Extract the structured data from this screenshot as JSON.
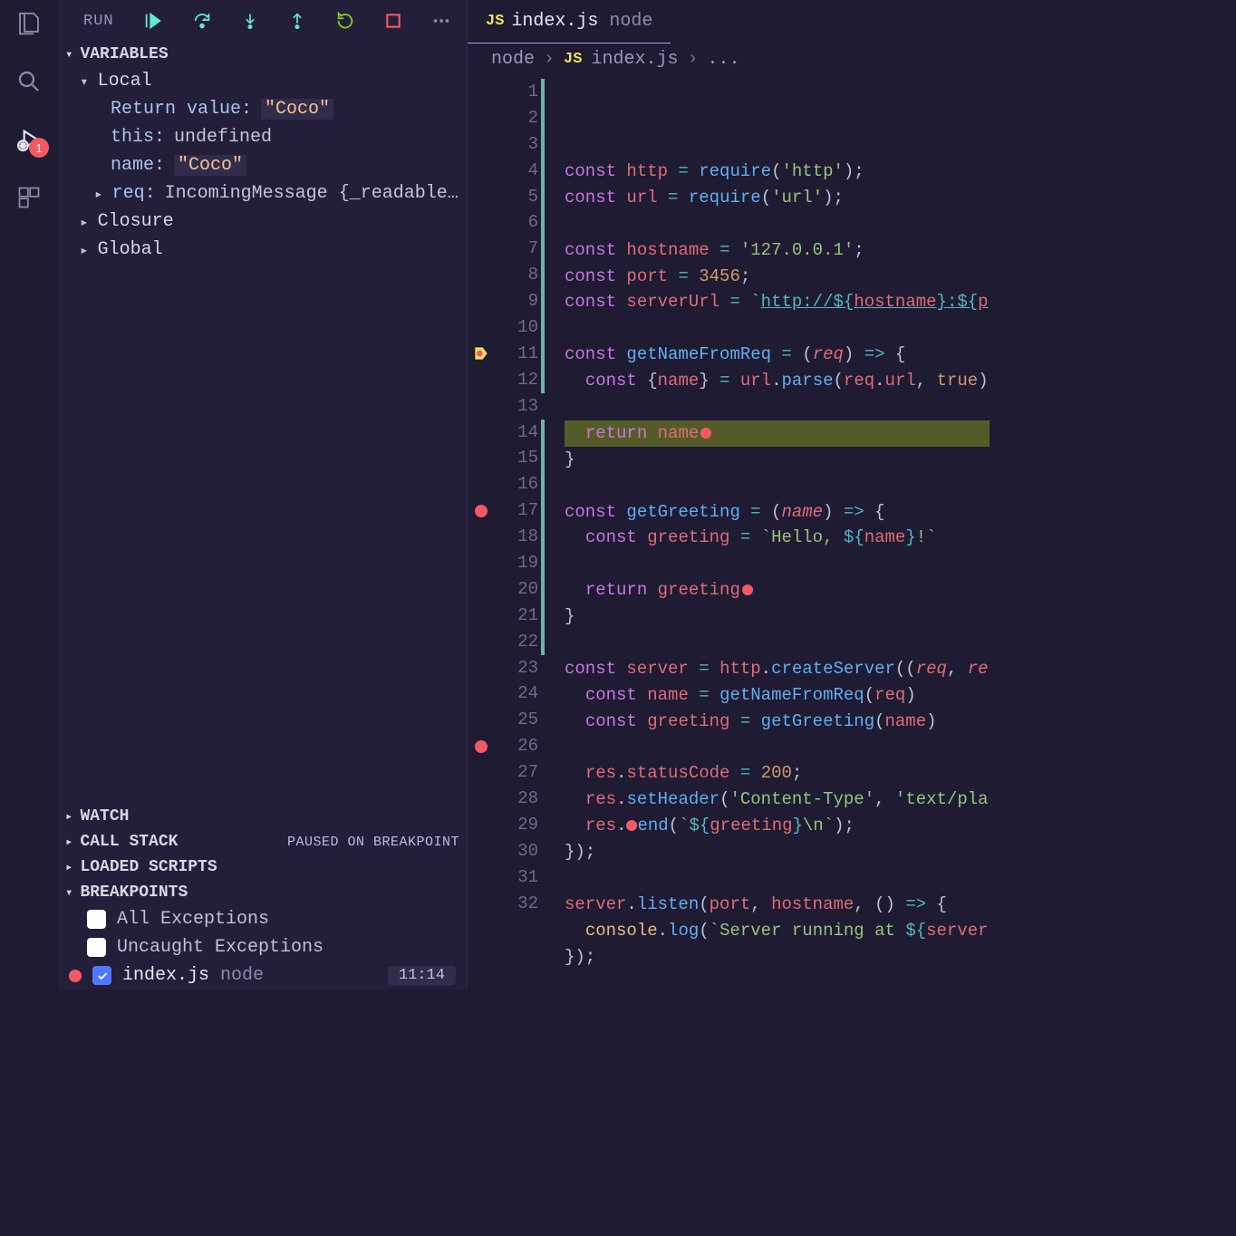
{
  "activity_badge": "1",
  "toolbar": {
    "run_label": "RUN"
  },
  "sections": {
    "variables": "VARIABLES",
    "watch": "WATCH",
    "callstack": "CALL STACK",
    "callstack_status": "PAUSED ON BREAKPOINT",
    "loaded": "LOADED SCRIPTS",
    "breakpoints": "BREAKPOINTS"
  },
  "scopes": {
    "local": "Local",
    "closure": "Closure",
    "global": "Global"
  },
  "vars": {
    "return_label": "Return value:",
    "return_val": "\"Coco\"",
    "this_label": "this:",
    "this_val": "undefined",
    "name_label": "name:",
    "name_val": "\"Coco\"",
    "req_label": "req:",
    "req_val": "IncomingMessage {_readableSta…"
  },
  "bp_items": {
    "all": "All Exceptions",
    "uncaught": "Uncaught Exceptions",
    "file": "index.js",
    "file_dim": "node",
    "line": "11:14"
  },
  "tab": {
    "js": "JS",
    "name": "index.js",
    "dim": "node"
  },
  "breadcrumb": {
    "p1": "node",
    "js": "JS",
    "p2": "index.js",
    "p3": "..."
  },
  "code": {
    "lines": [
      {
        "n": 1,
        "html": "<span class='kw'>const</span> <span class='id'>http</span> <span class='op'>=</span> <span class='fn'>require</span>(<span class='str'>'http'</span>);"
      },
      {
        "n": 2,
        "html": "<span class='kw'>const</span> <span class='id'>url</span> <span class='op'>=</span> <span class='fn'>require</span>(<span class='str'>'url'</span>);"
      },
      {
        "n": 3,
        "html": ""
      },
      {
        "n": 4,
        "html": "<span class='kw'>const</span> <span class='id'>hostname</span> <span class='op'>=</span> <span class='str'>'127.0.0.1'</span>;"
      },
      {
        "n": 5,
        "html": "<span class='kw'>const</span> <span class='id'>port</span> <span class='op'>=</span> <span class='num'>3456</span>;"
      },
      {
        "n": 6,
        "html": "<span class='kw'>const</span> <span class='id'>serverUrl</span> <span class='op'>=</span> <span class='str'>`</span><span class='link'>http://<span class='op'>${</span><span class='id'>hostname</span><span class='op'>}</span>:<span class='op'>${</span><span class='id'>p</span></span>"
      },
      {
        "n": 7,
        "html": ""
      },
      {
        "n": 8,
        "html": "<span class='kw'>const</span> <span class='fn'>getNameFromReq</span> <span class='op'>=</span> (<span class='param'>req</span>) <span class='op'>=&gt;</span> {"
      },
      {
        "n": 9,
        "html": "  <span class='kw'>const</span> {<span class='id'>name</span>} <span class='op'>=</span> <span class='id'>url</span>.<span class='fn'>parse</span>(<span class='id'>req</span>.<span class='id'>url</span>, <span class='num'>true</span>)"
      },
      {
        "n": 10,
        "html": ""
      },
      {
        "n": 11,
        "html": "  <span class='kw'>return</span> <span class='id'>name</span><span class='red-dot-small' style='vertical-align:middle;margin-left:2px'></span>",
        "current": true
      },
      {
        "n": 12,
        "html": "}"
      },
      {
        "n": 13,
        "html": ""
      },
      {
        "n": 14,
        "html": "<span class='kw'>const</span> <span class='fn'>getGreeting</span> <span class='op'>=</span> (<span class='param'>name</span>) <span class='op'>=&gt;</span> {"
      },
      {
        "n": 15,
        "html": "  <span class='kw'>const</span> <span class='id'>greeting</span> <span class='op'>=</span> <span class='str'>`Hello, <span class='op'>${</span><span class='id'>name</span><span class='op'>}</span>!`</span>"
      },
      {
        "n": 16,
        "html": ""
      },
      {
        "n": 17,
        "html": "  <span class='kw'>return</span> <span class='id'>greeting</span><span class='red-dot-small' style='vertical-align:middle;margin-left:2px'></span>",
        "bp": true
      },
      {
        "n": 18,
        "html": "}"
      },
      {
        "n": 19,
        "html": ""
      },
      {
        "n": 20,
        "html": "<span class='kw'>const</span> <span class='id'>server</span> <span class='op'>=</span> <span class='id'>http</span>.<span class='fn'>createServer</span>((<span class='param'>req</span>, <span class='param'>re</span>"
      },
      {
        "n": 21,
        "html": "  <span class='kw'>const</span> <span class='id'>name</span> <span class='op'>=</span> <span class='fn'>getNameFromReq</span>(<span class='id'>req</span>)"
      },
      {
        "n": 22,
        "html": "  <span class='kw'>const</span> <span class='id'>greeting</span> <span class='op'>=</span> <span class='fn'>getGreeting</span>(<span class='id'>name</span>)"
      },
      {
        "n": 23,
        "html": ""
      },
      {
        "n": 24,
        "html": "  <span class='id'>res</span>.<span class='id'>statusCode</span> <span class='op'>=</span> <span class='num'>200</span>;"
      },
      {
        "n": 25,
        "html": "  <span class='id'>res</span>.<span class='fn'>setHeader</span>(<span class='str'>'Content-Type'</span>, <span class='str'>'text/pla</span>"
      },
      {
        "n": 26,
        "html": "  <span class='id'>res</span>.<span class='red-dot-small' style='vertical-align:middle'></span><span class='fn'>end</span>(<span class='str'>`<span class='op'>${</span><span class='id'>greeting</span><span class='op'>}</span>\\n`</span>);",
        "bp": true
      },
      {
        "n": 27,
        "html": "});"
      },
      {
        "n": 28,
        "html": ""
      },
      {
        "n": 29,
        "html": "<span class='id'>server</span>.<span class='fn'>listen</span>(<span class='id'>port</span>, <span class='id'>hostname</span>, () <span class='op'>=&gt;</span> {"
      },
      {
        "n": 30,
        "html": "  <span class='prop'>console</span>.<span class='fn'>log</span>(<span class='str'>`Server running at <span class='op'>${</span><span class='id'>server</span></span>"
      },
      {
        "n": 31,
        "html": "});"
      },
      {
        "n": 32,
        "html": ""
      }
    ]
  }
}
